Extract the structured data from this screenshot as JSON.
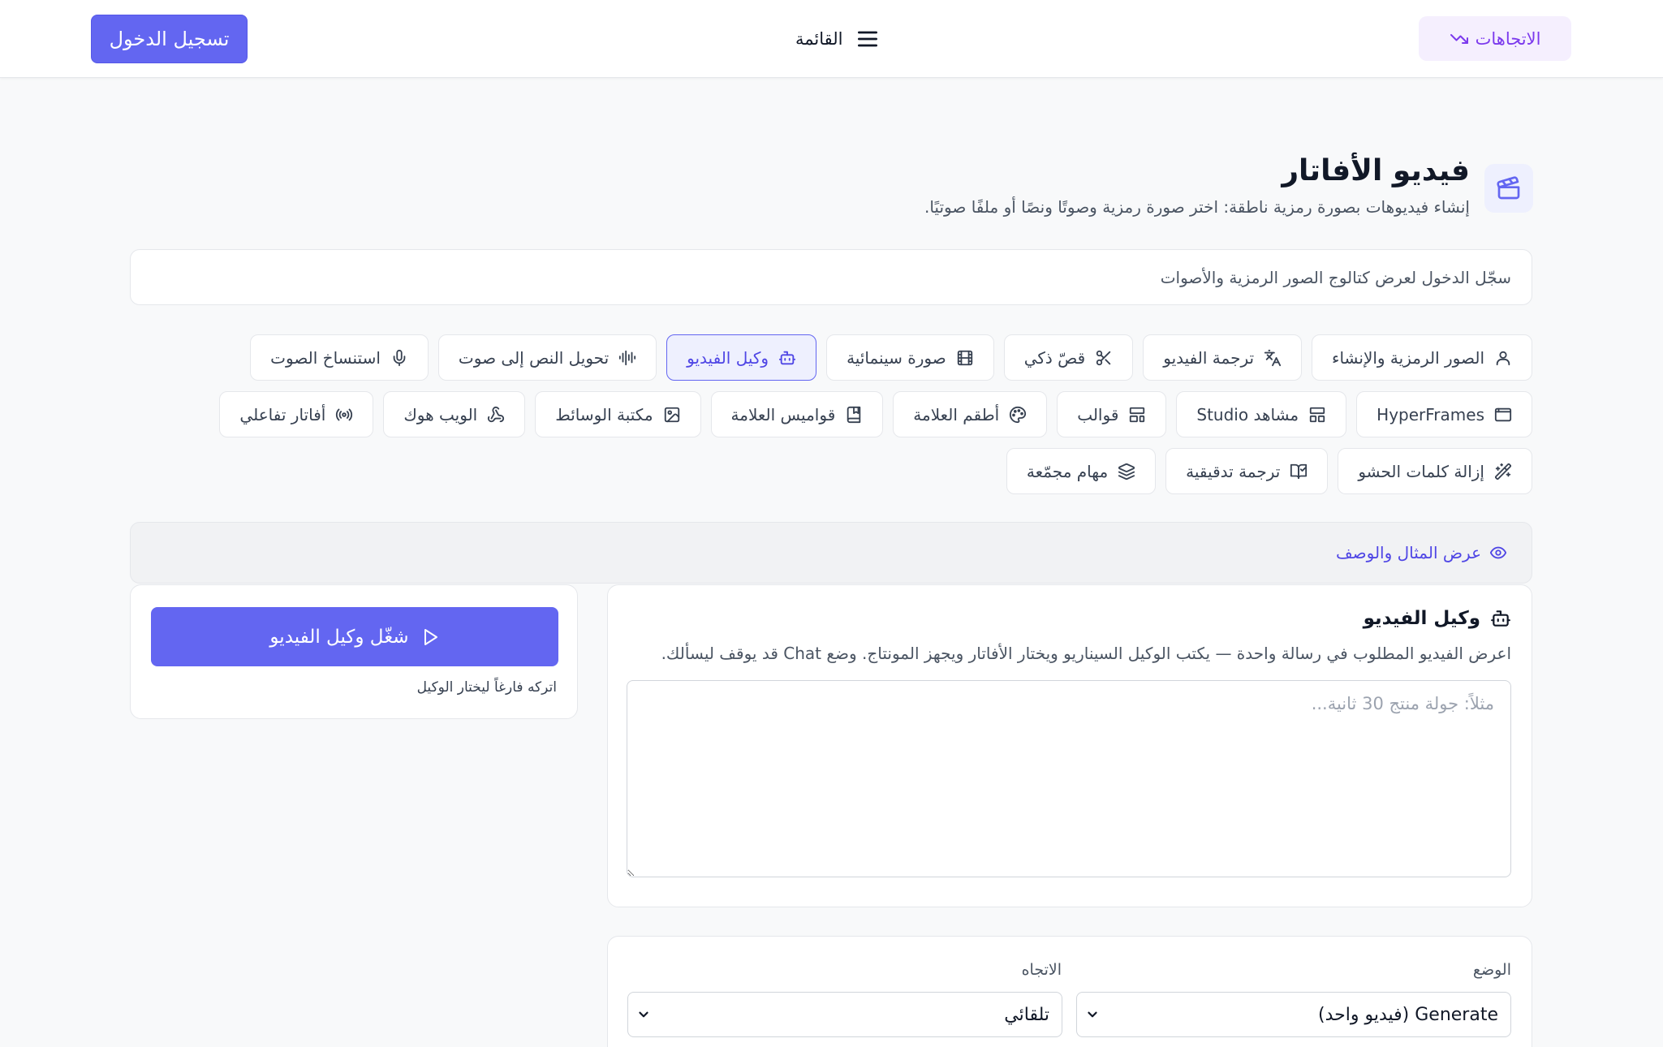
{
  "header": {
    "trends_label": "الاتجاهات",
    "menu_label": "القائمة",
    "login_label": "تسجيل الدخول"
  },
  "page": {
    "title": "فيديو الأفاتار",
    "subtitle": "إنشاء فيديوهات بصورة رمزية ناطقة: اختر صورة رمزية وصوتًا ونصًا أو ملفًا صوتيًا."
  },
  "login_banner": "سجّل الدخول لعرض كتالوج الصور الرمزية والأصوات",
  "tabs": [
    {
      "label": "الصور الرمزية والإنشاء",
      "icon": "user-icon"
    },
    {
      "label": "ترجمة الفيديو",
      "icon": "translate-icon"
    },
    {
      "label": "قصّ ذكي",
      "icon": "scissors-icon"
    },
    {
      "label": "صورة سينمائية",
      "icon": "film-icon"
    },
    {
      "label": "وكيل الفيديو",
      "icon": "bot-icon",
      "active": true
    },
    {
      "label": "تحويل النص إلى صوت",
      "icon": "audio-lines-icon"
    },
    {
      "label": "استنساخ الصوت",
      "icon": "mic-icon"
    },
    {
      "label": "HyperFrames",
      "icon": "app-window-icon"
    },
    {
      "label": "مشاهد Studio",
      "icon": "layout-icon"
    },
    {
      "label": "قوالب",
      "icon": "template-icon"
    },
    {
      "label": "أطقم العلامة",
      "icon": "palette-icon"
    },
    {
      "label": "قواميس العلامة",
      "icon": "book-icon"
    },
    {
      "label": "مكتبة الوسائط",
      "icon": "image-icon"
    },
    {
      "label": "الويب هوك",
      "icon": "webhook-icon"
    },
    {
      "label": "أفاتار تفاعلي",
      "icon": "radio-icon"
    },
    {
      "label": "إزالة كلمات الحشو",
      "icon": "wand-icon"
    },
    {
      "label": "ترجمة تدقيقية",
      "icon": "book-check-icon"
    },
    {
      "label": "مهام مجمّعة",
      "icon": "layers-icon"
    }
  ],
  "example_toggle": "عرض المثال والوصف",
  "agent": {
    "title": "وكيل الفيديو",
    "description": "اعرض الفيديو المطلوب في رسالة واحدة — يكتب الوكيل السيناريو ويختار الأفاتار ويجهز المونتاج. وضع Chat قد يوقف ليسألك.",
    "placeholder": "مثلاً: جولة منتج 30 ثانية..."
  },
  "run": {
    "button_label": "شغّل وكيل الفيديو",
    "hint": "اتركه فارغاً ليختار الوكيل"
  },
  "settings": {
    "mode_label": "الوضع",
    "mode_value": "Generate (فيديو واحد)",
    "orientation_label": "الاتجاه",
    "orientation_value": "تلقائي"
  },
  "colors": {
    "accent": "#6366f1",
    "accent_text": "#4f46e5",
    "trends": "#7c3aed"
  }
}
